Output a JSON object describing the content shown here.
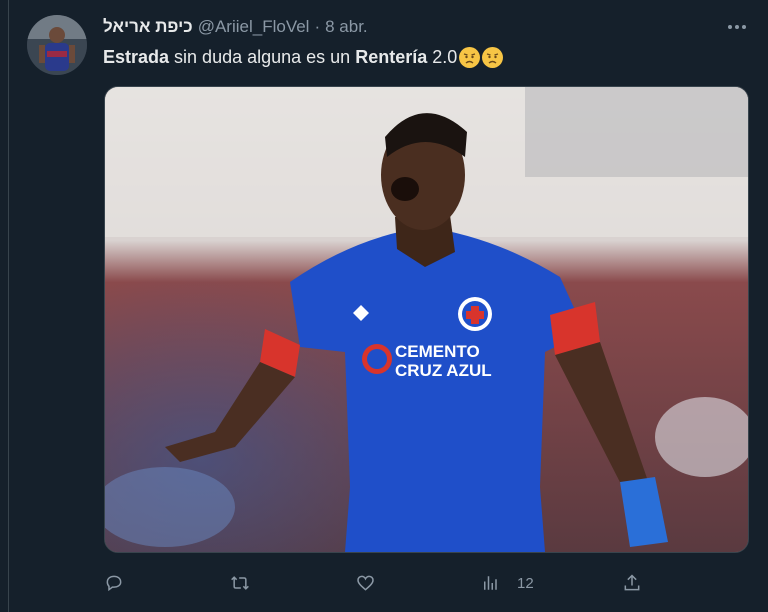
{
  "tweet": {
    "display_name": "כיפת אריאל",
    "handle": "@Ariiel_FloVel",
    "separator": "·",
    "date": "8 abr.",
    "text_bold_1": "Estrada",
    "text_mid": " sin duda alguna es un ",
    "text_bold_2": "Rentería",
    "text_end": " 2.0",
    "emojis": [
      "worried-face-icon",
      "worried-face-icon"
    ]
  },
  "media": {
    "jersey_brand": "CEMENTO",
    "jersey_brand_2": "CRUZ AZUL",
    "colors": {
      "jersey": "#1f4fc9",
      "armband": "#d8342c",
      "background": "#6e2a2e"
    }
  },
  "actions": {
    "reply_icon": "reply-icon",
    "retweet_icon": "retweet-icon",
    "like_icon": "heart-icon",
    "views_icon": "views-chart-icon",
    "views_count": "12",
    "share_icon": "share-icon"
  },
  "colors": {
    "background": "#15202b",
    "muted": "#8b98a5",
    "text": "#e7e9ea"
  }
}
